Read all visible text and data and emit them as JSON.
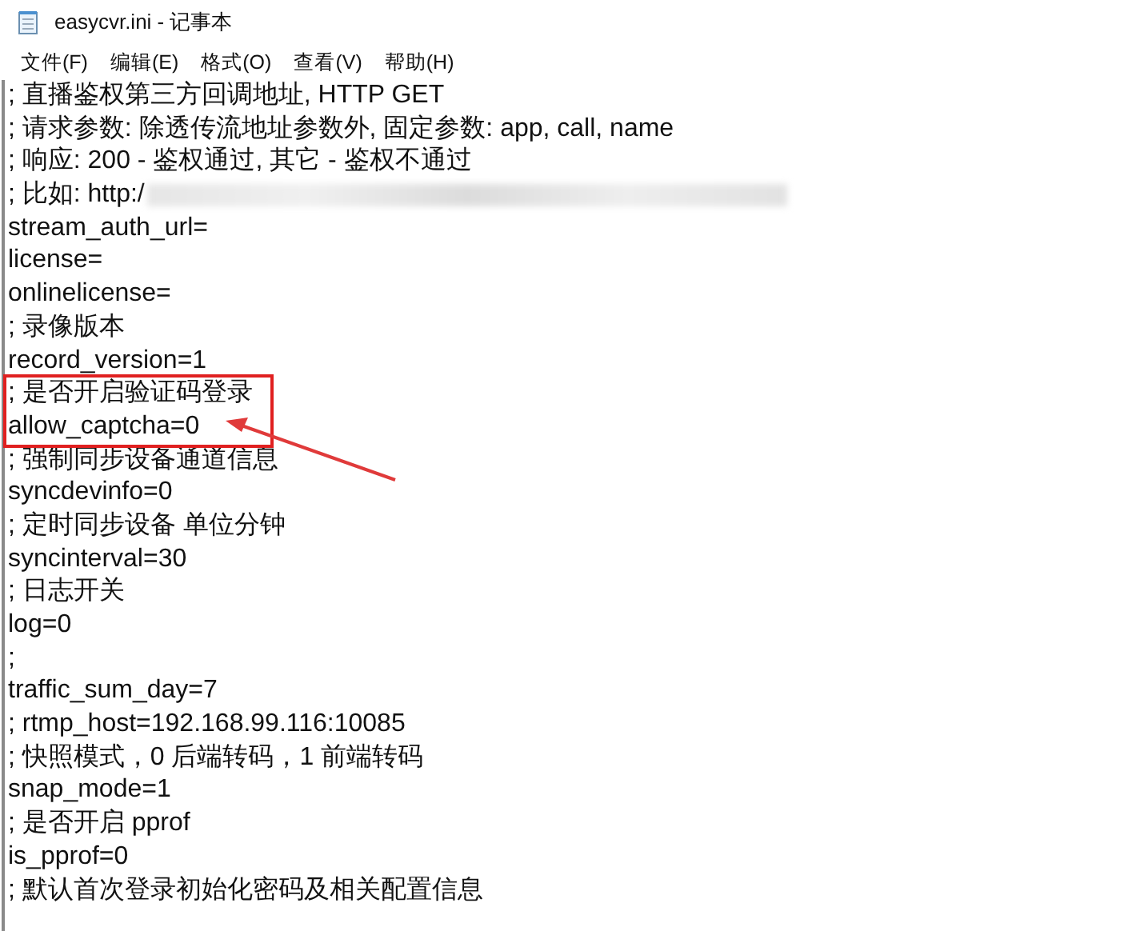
{
  "window": {
    "title": "easycvr.ini - 记事本"
  },
  "menu": [
    {
      "label": "文件(F)"
    },
    {
      "label": "编辑(E)"
    },
    {
      "label": "格式(O)"
    },
    {
      "label": "查看(V)"
    },
    {
      "label": "帮助(H)"
    }
  ],
  "editor": {
    "lines": [
      {
        "kind": "plain",
        "text": "; 直播鉴权第三方回调地址, HTTP GET"
      },
      {
        "kind": "plain",
        "text": "; 请求参数: 除透传流地址参数外, 固定参数: app, call, name"
      },
      {
        "kind": "plain",
        "text": "; 响应: 200 - 鉴权通过, 其它 - 鉴权不通过"
      },
      {
        "kind": "redacted",
        "text": "; 比如: http:/"
      },
      {
        "kind": "plain",
        "text": "stream_auth_url="
      },
      {
        "kind": "plain",
        "text": "license="
      },
      {
        "kind": "plain",
        "text": "onlinelicense="
      },
      {
        "kind": "plain",
        "text": "; 录像版本"
      },
      {
        "kind": "plain",
        "text": "record_version=1"
      },
      {
        "kind": "boxed",
        "lines": [
          "; 是否开启验证码登录",
          "allow_captcha=0"
        ]
      },
      {
        "kind": "plain",
        "text": "; 强制同步设备通道信息"
      },
      {
        "kind": "plain",
        "text": "syncdevinfo=0"
      },
      {
        "kind": "plain",
        "text": "; 定时同步设备 单位分钟"
      },
      {
        "kind": "plain",
        "text": "syncinterval=30"
      },
      {
        "kind": "plain",
        "text": "; 日志开关"
      },
      {
        "kind": "plain",
        "text": "log=0"
      },
      {
        "kind": "plain",
        "text": ";"
      },
      {
        "kind": "plain",
        "text": "traffic_sum_day=7"
      },
      {
        "kind": "plain",
        "text": "; rtmp_host=192.168.99.116:10085"
      },
      {
        "kind": "plain",
        "text": "; 快照模式，0 后端转码，1 前端转码"
      },
      {
        "kind": "plain",
        "text": "snap_mode=1"
      },
      {
        "kind": "plain",
        "text": "; 是否开启 pprof"
      },
      {
        "kind": "plain",
        "text": "is_pprof=0"
      },
      {
        "kind": "plain",
        "text": "; 默认首次登录初始化密码及相关配置信息"
      }
    ]
  }
}
